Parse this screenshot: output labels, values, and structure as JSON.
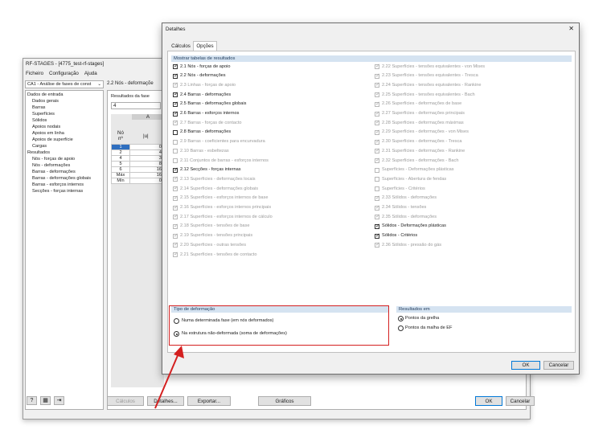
{
  "main": {
    "title": "RF-STAGES - [4775_test-rf-stages]",
    "menu": [
      "Ficheiro",
      "Configuração",
      "Ajuda"
    ],
    "case_select": "CA1 - Análise de fases de const",
    "panel_title": "2.2 Nós - deformaçõe",
    "results_label": "Resultados da fase",
    "results_value": "4",
    "tree": [
      "Dados de entrada",
      "Dados gerais",
      "Barras",
      "Superfícies",
      "Sólidos",
      "Apoios nodais",
      "Apoios em linha",
      "Apoios de superfície",
      "Cargas",
      "Resultados",
      "Nós - forças de apoio",
      "Nós - deformações",
      "Barras - deformações",
      "Barras - deformações globais",
      "Barras - esforços internos",
      "Secções - forças internas"
    ],
    "table": {
      "col_letter": "A",
      "hdr_no": "Nó",
      "hdr_no2": "nº",
      "hdr_u": "|u|",
      "rows": [
        [
          "1",
          "0"
        ],
        [
          "2",
          "4"
        ],
        [
          "4",
          "3"
        ],
        [
          "5",
          "8"
        ],
        [
          "6",
          "16"
        ],
        [
          "Máx",
          "16"
        ],
        [
          "Mín",
          "0"
        ]
      ]
    },
    "buttons": {
      "calculos": "Cálculos",
      "detalhes": "Detalhes...",
      "exportar": "Exportar...",
      "graficos": "Gráficos",
      "ok": "OK",
      "cancelar": "Cancelar"
    }
  },
  "dialog": {
    "title": "Detalhes",
    "close": "✕",
    "tabs": [
      "Cálculos",
      "Opções"
    ],
    "section_title": "Mostrar tabelas de resultados",
    "left_items": [
      {
        "label": "2.1 Nós - forças de apoio",
        "checked": true,
        "enabled": true
      },
      {
        "label": "2.2 Nós - deformações",
        "checked": true,
        "enabled": true
      },
      {
        "label": "2.3 Linhas - forças de apoio",
        "checked": true,
        "enabled": false
      },
      {
        "label": "2.4 Barras - deformações",
        "checked": true,
        "enabled": true
      },
      {
        "label": "2.5 Barras - deformações globais",
        "checked": true,
        "enabled": true
      },
      {
        "label": "2.6 Barras - esforços internos",
        "checked": true,
        "enabled": true
      },
      {
        "label": "2.7 Barras - forças de contacto",
        "checked": true,
        "enabled": false
      },
      {
        "label": "2.8 Barras - deformações",
        "checked": false,
        "enabled": true
      },
      {
        "label": "2.9 Barras - coeficientes para encurvadura",
        "checked": false,
        "enabled": false
      },
      {
        "label": "2.10 Barras - esbeltezas",
        "checked": false,
        "enabled": false
      },
      {
        "label": "2.11 Conjuntos de barras - esforços internos",
        "checked": false,
        "enabled": false
      },
      {
        "label": "2.12 Secções - forças internas",
        "checked": true,
        "enabled": true
      },
      {
        "label": "2.13 Superfícies - deformações locais",
        "checked": true,
        "enabled": false
      },
      {
        "label": "2.14 Superfícies - deformações globais",
        "checked": true,
        "enabled": false
      },
      {
        "label": "2.15 Superfícies - esforços internos de base",
        "checked": true,
        "enabled": false
      },
      {
        "label": "2.16 Superfícies - esforços internos principais",
        "checked": true,
        "enabled": false
      },
      {
        "label": "2.17 Superfícies - esforços internos de cálculo",
        "checked": true,
        "enabled": false
      },
      {
        "label": "2.18 Superfícies - tensões de base",
        "checked": true,
        "enabled": false
      },
      {
        "label": "2.19 Superfícies - tensões principais",
        "checked": true,
        "enabled": false
      },
      {
        "label": "2.20 Superfícies - outras tensões",
        "checked": true,
        "enabled": false
      },
      {
        "label": "2.21 Superfícies - tensões de contacto",
        "checked": true,
        "enabled": false
      }
    ],
    "right_items": [
      {
        "label": "2.22 Superfícies - tensões equivalentes - von Mises",
        "checked": true,
        "enabled": false
      },
      {
        "label": "2.23 Superfícies - tensões equivalentes - Tresca",
        "checked": true,
        "enabled": false
      },
      {
        "label": "2.24 Superfícies - tensões equivalentes - Rankine",
        "checked": true,
        "enabled": false
      },
      {
        "label": "2.25 Superfícies - tensões equivalentes - Bach",
        "checked": true,
        "enabled": false
      },
      {
        "label": "2.26 Superfícies - deformações de base",
        "checked": true,
        "enabled": false
      },
      {
        "label": "2.27 Superfícies - deformações principais",
        "checked": true,
        "enabled": false
      },
      {
        "label": "2.28 Superfícies - deformações máximas",
        "checked": true,
        "enabled": false
      },
      {
        "label": "2.29 Superfícies - deformações - von Mises",
        "checked": true,
        "enabled": false
      },
      {
        "label": "2.30 Superfícies - deformações - Tresca",
        "checked": true,
        "enabled": false
      },
      {
        "label": "2.31 Superfícies - deformações - Rankine",
        "checked": true,
        "enabled": false
      },
      {
        "label": "2.32 Superfícies - deformações - Bach",
        "checked": true,
        "enabled": false
      },
      {
        "label": "Superfícies - Deformações plásticas",
        "checked": false,
        "enabled": false
      },
      {
        "label": "Superfícies - Abertura de fendas",
        "checked": false,
        "enabled": false
      },
      {
        "label": "Superfícies - Critérios",
        "checked": false,
        "enabled": false
      },
      {
        "label": "2.33 Sólidos - deformações",
        "checked": true,
        "enabled": false
      },
      {
        "label": "2.34 Sólidos - tensões",
        "checked": true,
        "enabled": false
      },
      {
        "label": "2.35 Sólidos - deformações",
        "checked": true,
        "enabled": false
      },
      {
        "label": "Sólidos - Deformações plásticas",
        "checked": true,
        "enabled": true
      },
      {
        "label": "Sólidos - Critérios",
        "checked": true,
        "enabled": true
      },
      {
        "label": "2.36 Sólidos - pressão do gás",
        "checked": true,
        "enabled": false
      }
    ],
    "deform_title": "Tipo de deformação",
    "deform_options": [
      {
        "label": "Numa determinada fase (em nós deformados)",
        "selected": false
      },
      {
        "label": "Na estrutura não-deformada (soma de deformações)",
        "selected": true
      }
    ],
    "results_title": "Resultados em",
    "results_options": [
      {
        "label": "Pontos da grelha",
        "selected": true
      },
      {
        "label": "Pontos da malha de EF",
        "selected": false
      }
    ],
    "ok": "OK",
    "cancel": "Cancelar"
  },
  "colors": {
    "highlight_box": "#d42020",
    "arrow": "#d42020",
    "section_header": "#d5e3f1",
    "selected_row": "#2f6fbf"
  }
}
